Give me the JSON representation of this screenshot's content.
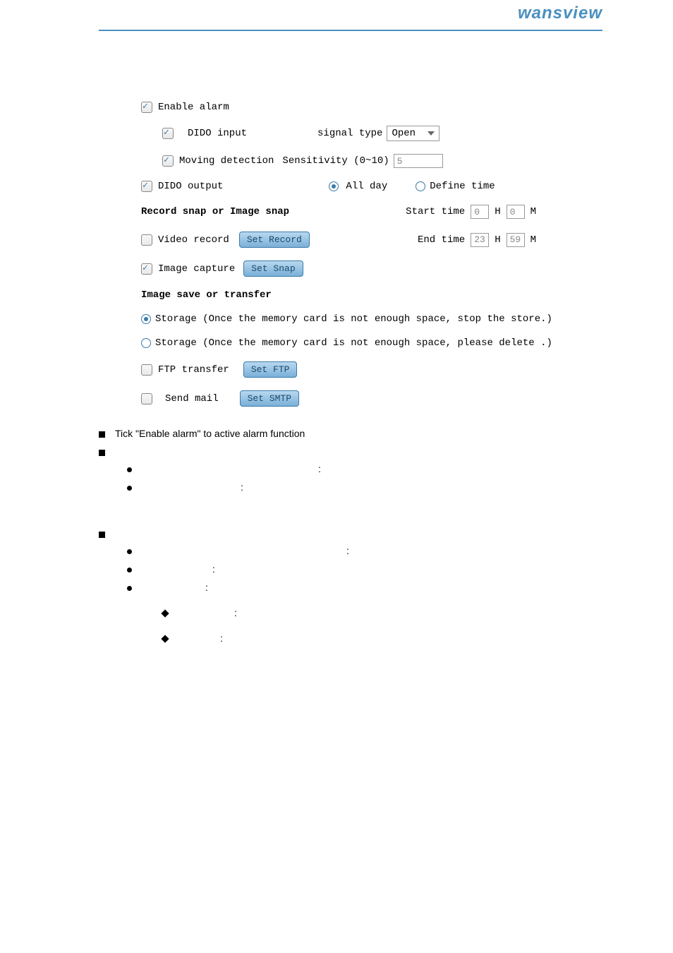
{
  "logo": "wansview",
  "form": {
    "enable_alarm": "Enable alarm",
    "dido_input": "DIDO input",
    "signal_type_label": "signal type",
    "signal_type_value": "Open",
    "moving_detection": "Moving detection",
    "sensitivity_label": "Sensitivity (0~10)",
    "sensitivity_value": "5",
    "dido_output": "DIDO output",
    "all_day": "All day",
    "define_time": "Define time",
    "section_record": "Record snap or Image snap",
    "start_time": "Start time",
    "start_h": "0",
    "start_m": "0",
    "end_time": "End time",
    "end_h": "23",
    "end_m": "59",
    "h_label": "H",
    "m_label": "M",
    "video_record": "Video record",
    "set_record_btn": "Set Record",
    "image_capture": "Image capture",
    "set_snap_btn": "Set Snap",
    "section_image": "Image save or transfer",
    "storage_stop": "Storage (Once the memory card is not enough space, stop the store.)",
    "storage_delete": "Storage (Once the memory card is not enough space, please delete .)",
    "ftp_transfer": "FTP transfer",
    "set_ftp_btn": "Set FTP",
    "send_mail": "Send mail",
    "set_smtp_btn": "Set SMTP"
  },
  "notes": {
    "tick_enable": "Tick \"Enable alarm\" to active alarm function",
    "colon": ":"
  }
}
